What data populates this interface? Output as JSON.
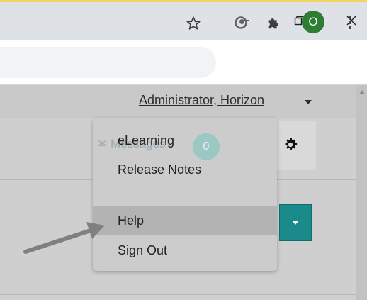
{
  "window_controls": {
    "minimize": "minimize-icon",
    "maximize": "maximize-icon",
    "close": "close-icon"
  },
  "toolbar": {
    "profile_initial": "O",
    "icons": [
      "star-icon",
      "extension-icon",
      "puzzle-icon",
      "kebab-icon"
    ]
  },
  "header": {
    "user_menu_label": "Administrator, Horizon"
  },
  "background": {
    "messages_label": "Messages",
    "messages_count": "0"
  },
  "menu": {
    "items": [
      {
        "label": "eLearning"
      },
      {
        "label": "Release Notes"
      },
      {
        "label": "Help"
      },
      {
        "label": "Sign Out"
      }
    ]
  },
  "colors": {
    "profile_green": "#2e7d32",
    "teal_button": "#1a8a8a",
    "menu_background": "#cccccc",
    "menu_hover": "#b3b3b3"
  }
}
